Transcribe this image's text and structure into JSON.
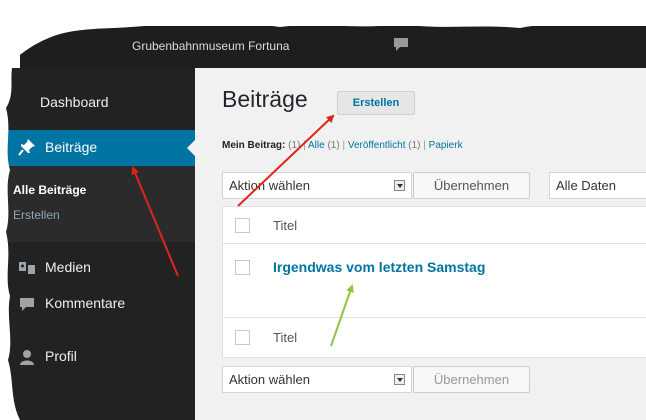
{
  "admin_bar": {
    "site_name": "Grubenbahnmuseum Fortuna"
  },
  "sidebar": {
    "dashboard": "Dashboard",
    "posts": "Beiträge",
    "submenu_all": "Alle Beiträge",
    "submenu_new": "Erstellen",
    "media": "Medien",
    "comments": "Kommentare",
    "profile": "Profil"
  },
  "main": {
    "title": "Beiträge",
    "add_new": "Erstellen",
    "views": {
      "mine_label": "Mein Beitrag:",
      "mine_count": "(1)",
      "all_label": "Alle",
      "all_count": "(1)",
      "published_label": "Veröffentlicht",
      "published_count": "(1)",
      "trash_label": "Papierk"
    },
    "bulk_action": "Aktion wählen",
    "apply": "Übernehmen",
    "all_dates": "Alle Daten",
    "table": {
      "column_title": "Titel",
      "posts": [
        "Irgendwas vom letzten Samstag"
      ]
    },
    "apply_bottom": "Übernehmen"
  },
  "colors": {
    "accent": "#0074a2",
    "sidebar_bg": "#222222",
    "arrow_red": "#e2231a",
    "arrow_green": "#8dc63f"
  }
}
